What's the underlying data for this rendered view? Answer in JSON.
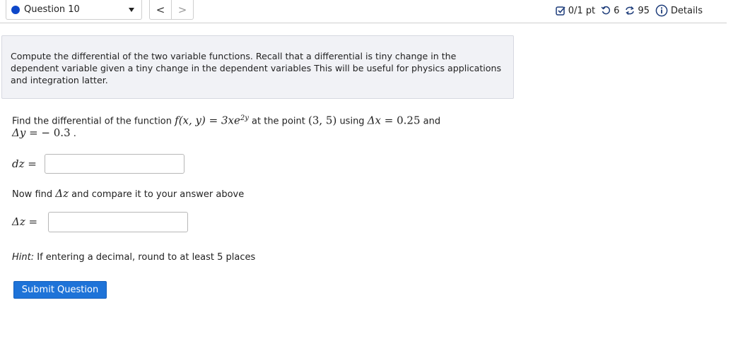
{
  "header": {
    "question_label": "Question 10",
    "prev_label": "<",
    "next_label": ">",
    "score": "0/1 pt",
    "retries": "6",
    "attempts": "95",
    "details": "Details"
  },
  "intro": {
    "text": "Compute the differential of the two variable functions.  Recall that a differential is tiny change in the dependent variable given a tiny change in the dependent variables  This will be useful for physics applications and integration latter."
  },
  "question": {
    "prefix": "Find the differential of the function ",
    "function": "f(x, y)",
    "equals": " = ",
    "expr": "3xe",
    "expr_exp": "2y",
    "at_point": " at the point ",
    "point": "(3, 5)",
    "using": " using ",
    "dx": "Δx",
    "dx_val": "0.25",
    "and": " and",
    "dy": "Δy",
    "dy_val": "− 0.3",
    "period": " ."
  },
  "dz": {
    "label": "dz",
    "eq": " =",
    "value": ""
  },
  "compare": {
    "pre": "Now find ",
    "sym": "Δz",
    "post": " and compare it to your answer above"
  },
  "Dz": {
    "label": "Δz",
    "eq": " =",
    "value": ""
  },
  "hint": {
    "label": "Hint:",
    "text": " If entering a decimal, round to at least 5 places"
  },
  "submit_label": "Submit Question",
  "colors": {
    "accent": "#1e73d8",
    "dot": "#0d47c9",
    "panel_bg": "#f1f2f6"
  }
}
